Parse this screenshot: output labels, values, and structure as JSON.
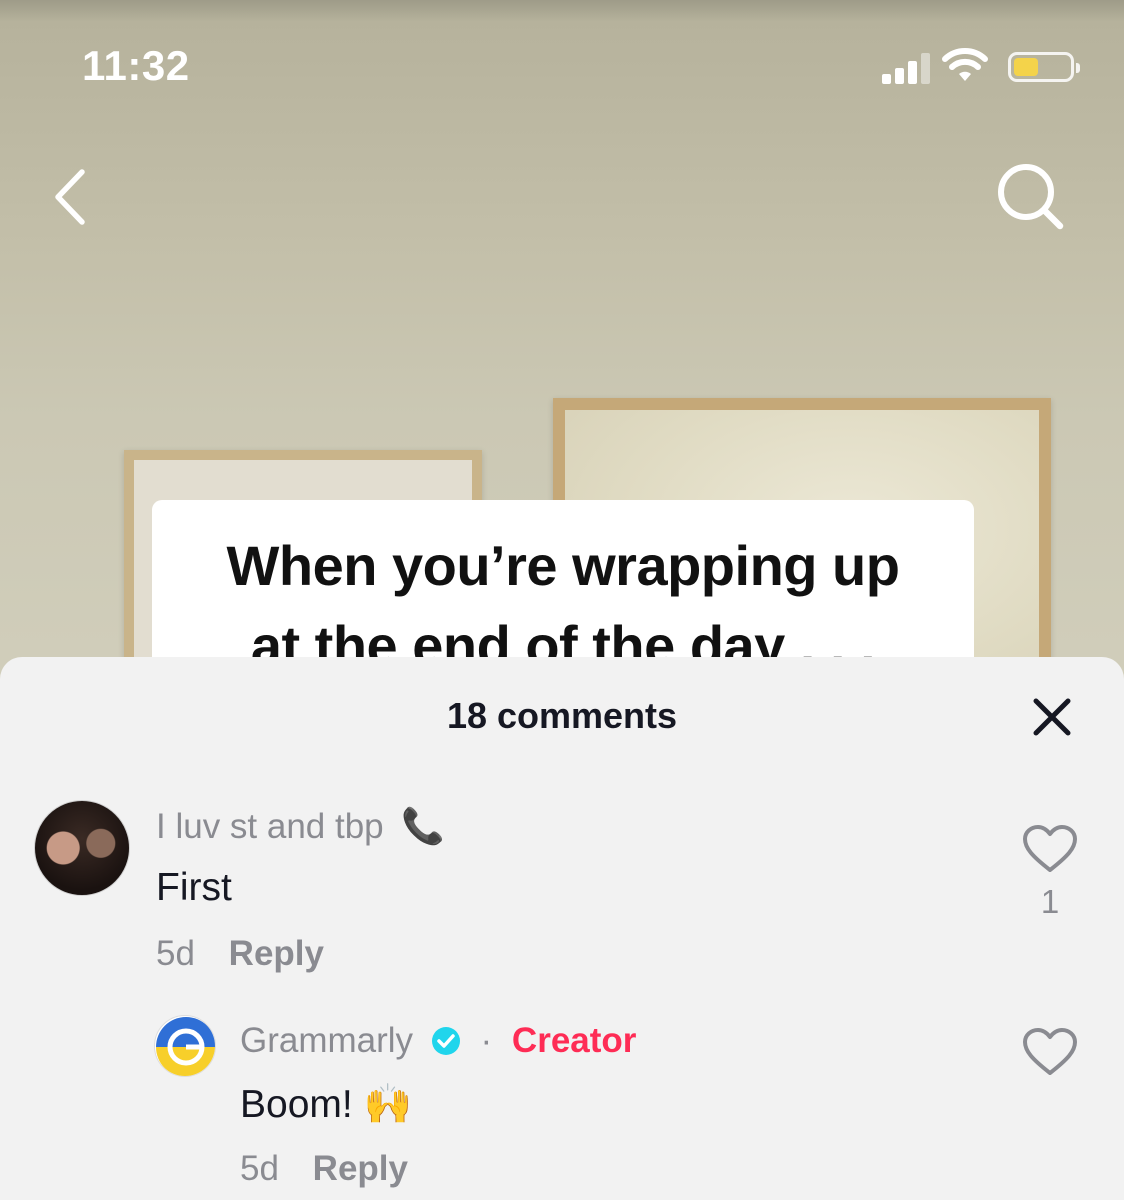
{
  "status_bar": {
    "time": "11:32",
    "battery_level": 0.45,
    "battery_color": "#f4d34a",
    "icons": [
      "cellular-signal-icon",
      "wifi-icon",
      "battery-icon"
    ]
  },
  "nav": {
    "back_icon": "chevron-left-icon",
    "search_icon": "search-icon"
  },
  "video": {
    "caption_line1": "When you’re wrapping up",
    "caption_line2": "at the end of the day . . ."
  },
  "comments_sheet": {
    "title": "18 comments",
    "close_icon": "close-icon",
    "comments": [
      {
        "username": "I luv st and tbp",
        "username_emoji": "📞",
        "text": "First",
        "age": "5d",
        "reply_label": "Reply",
        "likes": "1",
        "avatar_icon": "user-avatar"
      },
      {
        "username": "Grammarly",
        "verified_icon": "verified-badge-icon",
        "separator": "·",
        "badge": "Creator",
        "text": "Boom!",
        "text_emoji": "🙌",
        "age": "5d",
        "reply_label": "Reply",
        "avatar_icon": "grammarly-logo"
      }
    ]
  },
  "colors": {
    "accent_creator": "#fe2c55",
    "verified": "#20d5ec",
    "sheet_bg": "#f2f2f2"
  }
}
